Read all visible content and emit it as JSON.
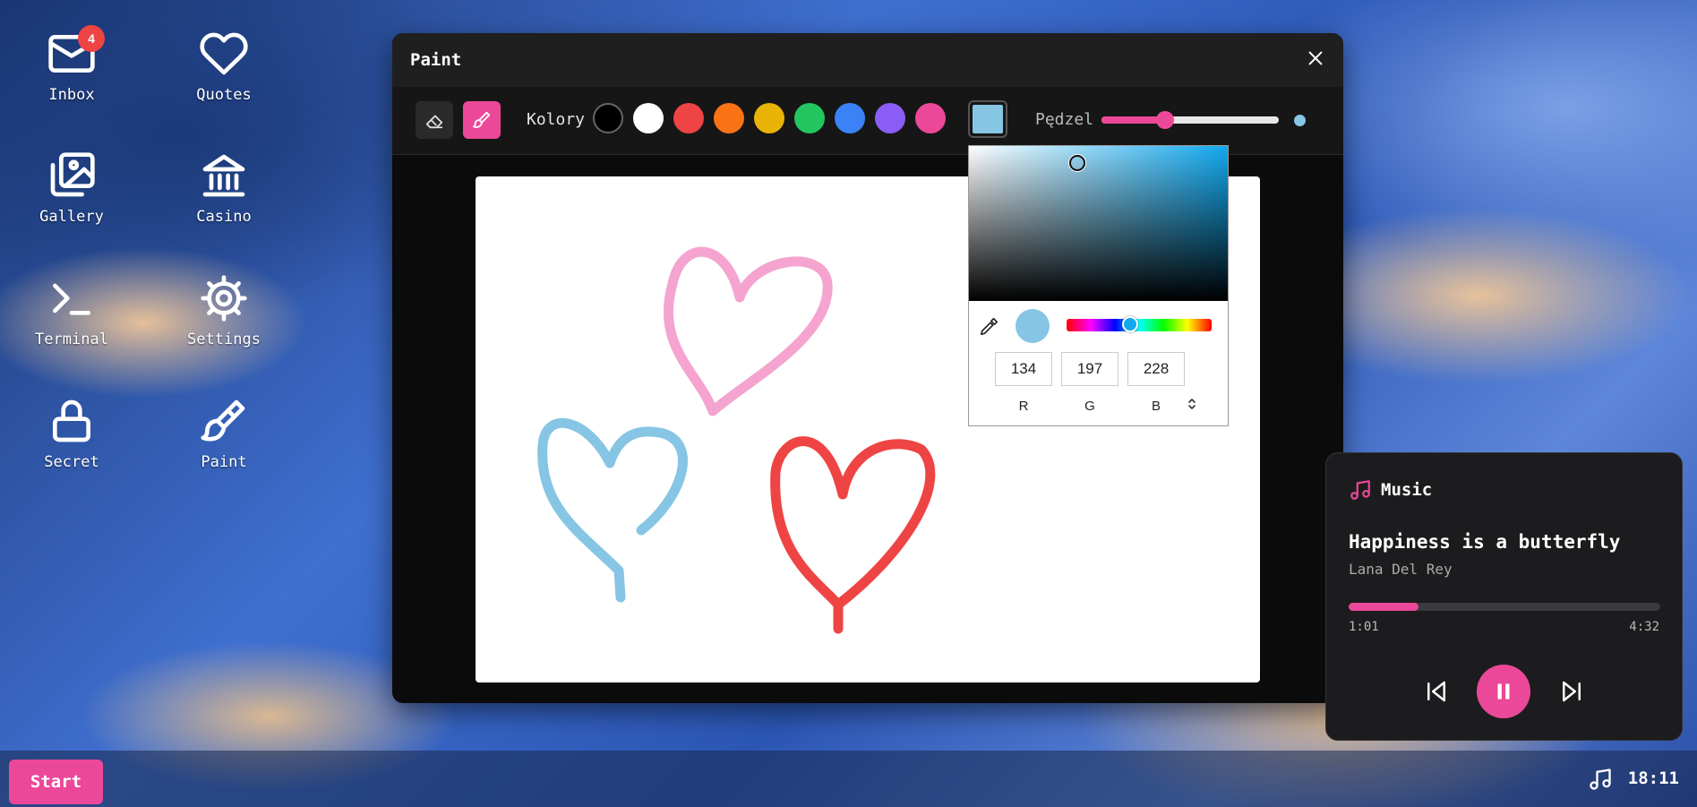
{
  "desktop": {
    "icons": [
      {
        "label": "Inbox",
        "icon": "mail-icon",
        "badge": "4"
      },
      {
        "label": "Quotes",
        "icon": "heart-icon"
      },
      {
        "label": "Gallery",
        "icon": "gallery-icon"
      },
      {
        "label": "Casino",
        "icon": "bank-icon"
      },
      {
        "label": "Terminal",
        "icon": "terminal-icon"
      },
      {
        "label": "Settings",
        "icon": "gear-icon"
      },
      {
        "label": "Secret",
        "icon": "lock-icon"
      },
      {
        "label": "Paint",
        "icon": "paintbrush-icon"
      }
    ]
  },
  "paint": {
    "title": "Paint",
    "colors_label": "Kolory",
    "brush_label": "Pędzel",
    "palette": [
      "#000000",
      "#ffffff",
      "#ef4444",
      "#f97316",
      "#eab308",
      "#22c55e",
      "#3b82f6",
      "#8b5cf6",
      "#ec4899"
    ],
    "selected_color": "#86c5e4",
    "brush_size_fraction": 0.36,
    "picker": {
      "r": "134",
      "g": "197",
      "b": "228",
      "r_label": "R",
      "g_label": "G",
      "b_label": "B",
      "hue_fraction": 0.44
    },
    "drawing_colors": {
      "pink": "#f4a4cf",
      "blue": "#86c5e4",
      "red": "#ef4444"
    }
  },
  "music": {
    "title": "Music",
    "song": "Happiness is a butterfly",
    "artist": "Lana Del Rey",
    "current_time": "1:01",
    "duration": "4:32",
    "progress_fraction": 0.225
  },
  "taskbar": {
    "start_label": "Start",
    "clock": "18:11"
  },
  "accent": "#ec4899"
}
